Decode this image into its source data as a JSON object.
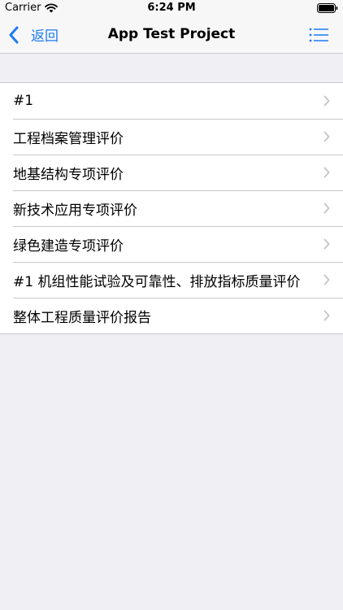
{
  "status_bar": {
    "carrier": "Carrier",
    "time": "6:24 PM"
  },
  "nav": {
    "back_label": "返回",
    "title": "App Test Project"
  },
  "list": {
    "items": [
      {
        "label": "#1"
      },
      {
        "label": "工程档案管理评价"
      },
      {
        "label": "地基结构专项评价"
      },
      {
        "label": "新技术应用专项评价"
      },
      {
        "label": "绿色建造专项评价"
      },
      {
        "label": "#1 机组性能试验及可靠性、排放指标质量评价"
      },
      {
        "label": "整体工程质量评价报告"
      }
    ]
  },
  "colors": {
    "accent": "#1D7AF3",
    "background": "#EFEFF4",
    "separator": "#C8C7CC",
    "chevron": "#C7C7CC"
  }
}
